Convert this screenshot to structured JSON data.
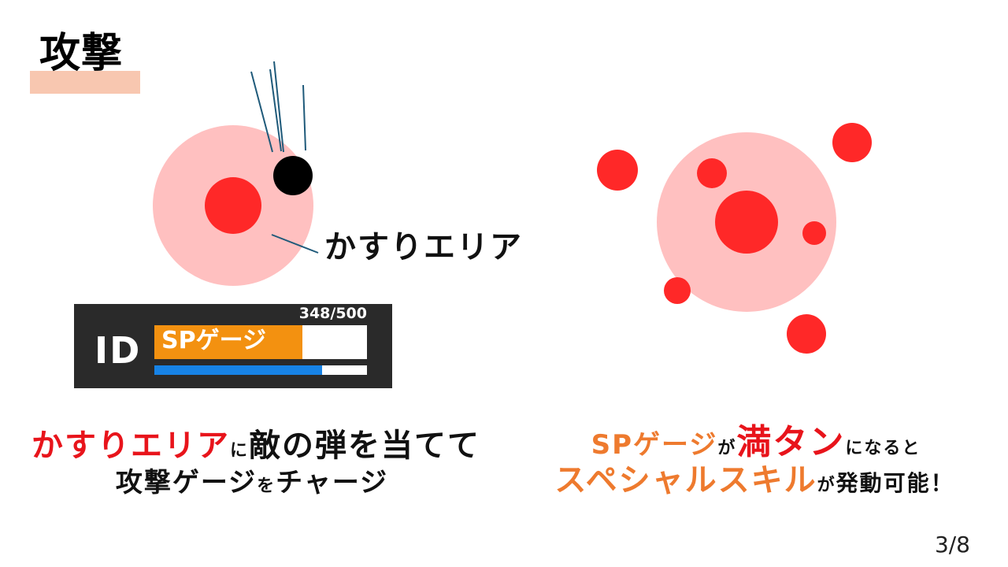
{
  "slide": {
    "title": "攻撃",
    "page_number": "3/8"
  },
  "diagram_left": {
    "area_label": "かすりエリア"
  },
  "hud": {
    "id_text": "ID",
    "sp_count": "348/500",
    "gauge_label": "SPゲージ",
    "sp_fill_fraction": 0.696,
    "blue_bar_fill_fraction": 0.79,
    "colors": {
      "panel": "#2a2a2a",
      "sp_gauge": "#f39110",
      "blue_bar": "#1783e6"
    }
  },
  "caption_left": {
    "line1": {
      "highlight": "かすりエリア",
      "particle": "に",
      "rest": "敵の弾を当てて"
    },
    "line2": {
      "part1": "攻撃ゲージ",
      "particle": "を",
      "part2": "チャージ"
    }
  },
  "caption_right": {
    "line1": {
      "highlight": "SPゲージ",
      "particle": "が",
      "emphasis": "満タン",
      "rest": "になると"
    },
    "line2": {
      "highlight": "スペシャルスキル",
      "particle": "が",
      "rest": "発動可能！"
    }
  },
  "colors": {
    "hitbox_area": "#ffc0c0",
    "bullet": "#ff2828",
    "player": "#000000",
    "leader_line": "#1f5a7a",
    "title_underline": "#f8c7b0",
    "text_red": "#e8141b",
    "text_orange": "#ee7a2e"
  }
}
